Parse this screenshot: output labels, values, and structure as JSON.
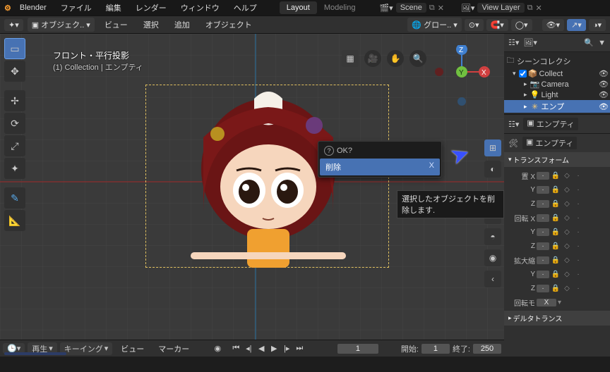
{
  "menu": {
    "app": "Blender",
    "items": [
      "ファイル",
      "編集",
      "レンダー",
      "ウィンドウ",
      "ヘルプ"
    ]
  },
  "workspaces": {
    "active": "Layout",
    "other": "Modeling"
  },
  "scene": {
    "label": "Scene",
    "layer": "View Layer"
  },
  "hdr": {
    "mode": "オブジェク..",
    "view": "ビュー",
    "select": "選択",
    "add": "追加",
    "object": "オブジェクト",
    "overlay": "グロー.."
  },
  "viewinfo": {
    "title": "フロント・平行投影",
    "sub": "(1) Collection | エンプティ"
  },
  "gizmo": {
    "x": "X",
    "y": "Y",
    "z": "Z"
  },
  "popup": {
    "prompt": "OK?",
    "action": "削除",
    "shortcut": "X"
  },
  "tooltip": "選択したオブジェクトを削除します.",
  "timeline": {
    "play": "再生",
    "keying": "キーイング",
    "view": "ビュー",
    "marker": "マーカー",
    "frame": "1",
    "start_label": "開始:",
    "start": "1",
    "end_label": "終了:",
    "end": "250"
  },
  "outliner": {
    "title": "シーンコレクシ",
    "items": [
      {
        "name": "Collect",
        "icon": "📦"
      },
      {
        "name": "Camera",
        "icon": "📷"
      },
      {
        "name": "Light",
        "icon": "💡"
      },
      {
        "name": "エンプ",
        "icon": "✳"
      }
    ]
  },
  "props": {
    "context1": "エンプティ",
    "context2": "エンプティ",
    "panel1": "トランスフォーム",
    "loc_label": "置",
    "rot_label": "回転",
    "scale_label": "拡大縮",
    "axes": [
      "X",
      "Y",
      "Z"
    ],
    "rot_mode_label": "回転モ",
    "rot_mode_val": "X",
    "panel2": "デルタトランス"
  }
}
